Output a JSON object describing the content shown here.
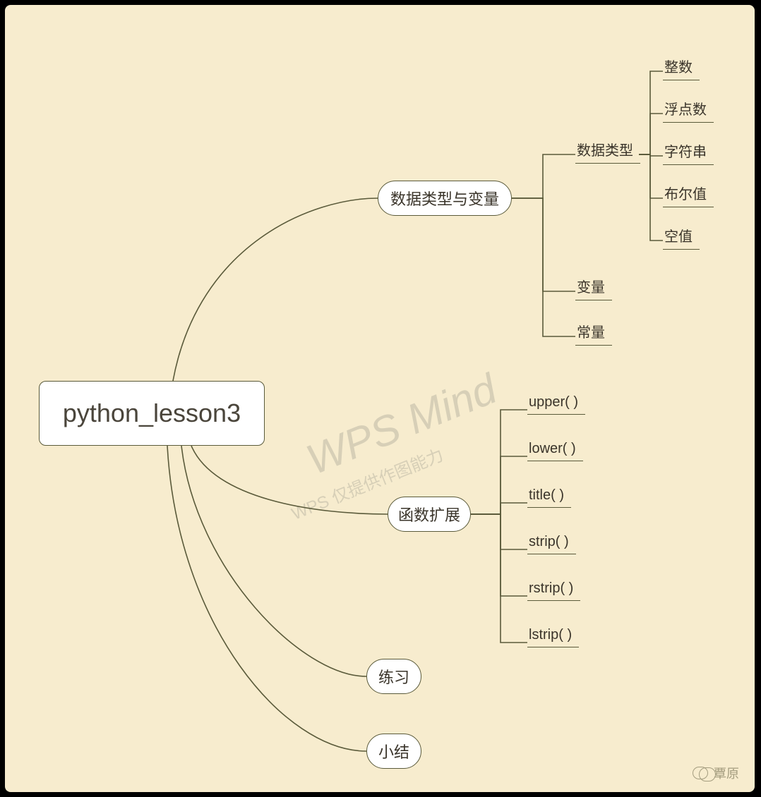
{
  "root": {
    "title": "python_lesson3"
  },
  "branches": {
    "b1": {
      "label": "数据类型与变量"
    },
    "b2": {
      "label": "函数扩展"
    },
    "b3": {
      "label": "练习"
    },
    "b4": {
      "label": "小结"
    }
  },
  "sub": {
    "s1": {
      "label": "数据类型"
    },
    "s2": {
      "label": "变量"
    },
    "s3": {
      "label": "常量"
    }
  },
  "leaves": {
    "l1": {
      "label": "整数"
    },
    "l2": {
      "label": "浮点数"
    },
    "l3": {
      "label": "字符串"
    },
    "l4": {
      "label": "布尔值"
    },
    "l5": {
      "label": "空值"
    },
    "l6": {
      "label": "upper( )"
    },
    "l7": {
      "label": "lower( )"
    },
    "l8": {
      "label": "title( )"
    },
    "l9": {
      "label": "strip( )"
    },
    "l10": {
      "label": "rstrip( )"
    },
    "l11": {
      "label": "lstrip( )"
    }
  },
  "watermark": {
    "main": "WPS Mind",
    "sub": "WPS 仅提供作图能力"
  },
  "footer": {
    "author": "覃原"
  }
}
